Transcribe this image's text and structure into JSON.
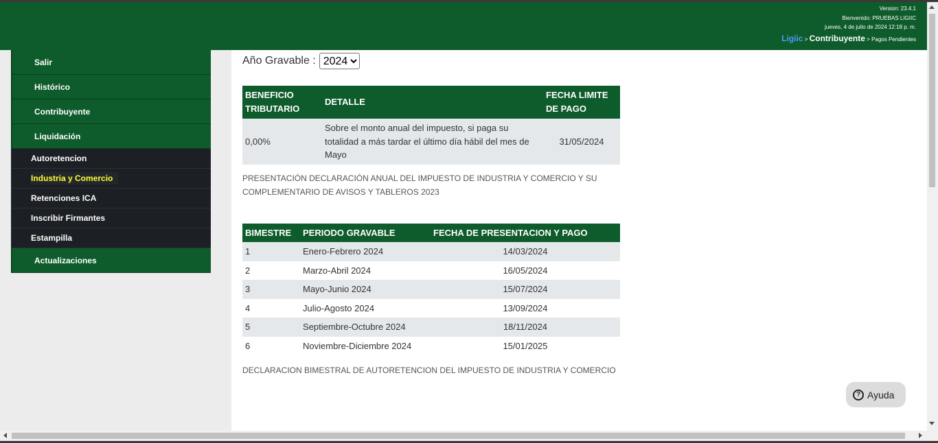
{
  "header": {
    "version": "Version: 23.4.1",
    "welcome": "Bienvenido: PRUEBAS LIGIIC",
    "datetime": "jueves, 4 de julio de 2024 12:18 p. m.",
    "breadcrumb": {
      "home": "Ligiic",
      "sep1": " > ",
      "section": "Contribuyente",
      "sep2": " > ",
      "page": "Pagos Pendientes"
    }
  },
  "sidebar": {
    "items": [
      {
        "label": "Salir"
      },
      {
        "label": "Histórico"
      },
      {
        "label": "Contribuyente"
      },
      {
        "label": "Liquidación"
      }
    ],
    "submenu": [
      {
        "label": "Autoretencion"
      },
      {
        "label": "Industria y Comercio"
      },
      {
        "label": "Retenciones ICA"
      },
      {
        "label": "Inscribir Firmantes"
      },
      {
        "label": "Estampilla"
      }
    ],
    "last_item": {
      "label": "Actualizaciones"
    }
  },
  "filter": {
    "year_label": "Año Gravable :",
    "year_value": "2024"
  },
  "benefit_table": {
    "headers": [
      "BENEFICIO TRIBUTARIO",
      "DETALLE",
      "FECHA LIMITE DE PAGO"
    ],
    "rows": [
      {
        "benefit": "0,00%",
        "detail": "Sobre el monto anual del impuesto, si paga su totalidad a más tardar el último día hábil del mes de Mayo",
        "date": "31/05/2024"
      }
    ]
  },
  "annual_note": "PRESENTACIÓN DECLARACIÓN ANUAL DEL IMPUESTO DE INDUSTRIA Y COMERCIO Y SU COMPLEMENTARIO DE AVISOS Y TABLEROS 2023",
  "bimester_table": {
    "headers": [
      "BIMESTRE",
      "PERIODO GRAVABLE",
      "FECHA DE PRESENTACION Y PAGO"
    ],
    "rows": [
      {
        "bimestre": "1",
        "period": "Enero-Febrero 2024",
        "date": "14/03/2024"
      },
      {
        "bimestre": "2",
        "period": "Marzo-Abril 2024",
        "date": "16/05/2024"
      },
      {
        "bimestre": "3",
        "period": "Mayo-Junio 2024",
        "date": "15/07/2024"
      },
      {
        "bimestre": "4",
        "period": "Julio-Agosto 2024",
        "date": "13/09/2024"
      },
      {
        "bimestre": "5",
        "period": "Septiembre-Octubre 2024",
        "date": "18/11/2024"
      },
      {
        "bimestre": "6",
        "period": "Noviembre-Diciembre 2024",
        "date": "15/01/2025"
      }
    ]
  },
  "bimester_note": "DECLARACION BIMESTRAL DE AUTORETENCION DEL IMPUESTO DE INDUSTRIA Y COMERCIO",
  "help": {
    "label": "Ayuda",
    "icon": "question-circle-icon",
    "icon_glyph": "?"
  },
  "colors": {
    "brand_green": "#0e5c2b",
    "submenu_dark": "#1c1f24",
    "active_highlight": "#ffff33",
    "breadcrumb_link": "#4a9cff"
  }
}
